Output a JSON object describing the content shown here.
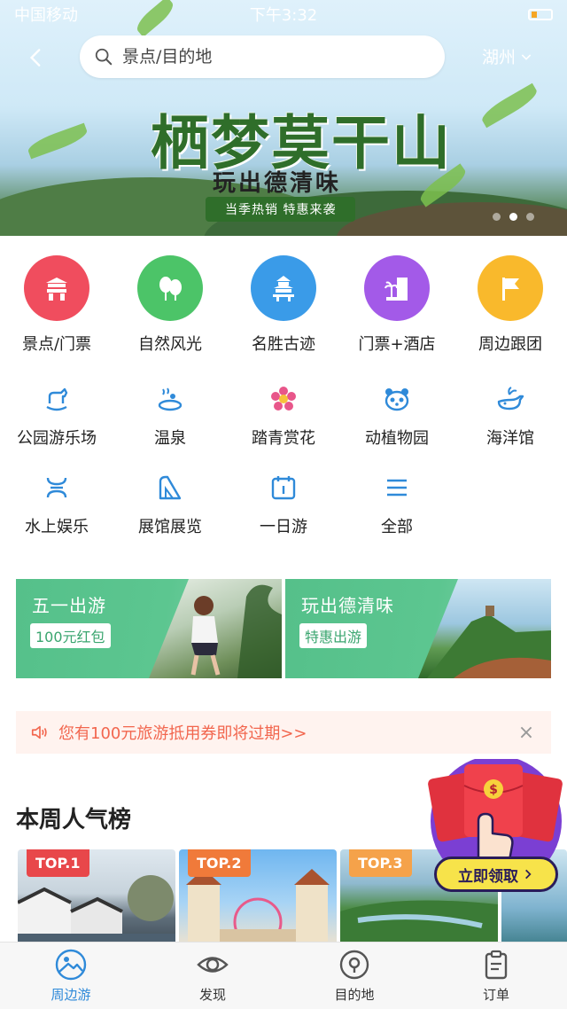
{
  "status_bar": {
    "carrier": "中国移动",
    "time": "下午3:32",
    "battery_icon": "battery-icon"
  },
  "header": {
    "search_placeholder": "景点/目的地",
    "city": "湖州"
  },
  "banner": {
    "title": "栖梦莫干山",
    "subtitle": "玩出德清味",
    "tag": "当季热销  特惠来袭",
    "slide_count": 3,
    "active_slide": 2
  },
  "categories_primary": [
    {
      "label": "景点/门票",
      "icon": "gate-icon",
      "color": "#f04d5e"
    },
    {
      "label": "自然风光",
      "icon": "tree-icon",
      "color": "#4cc468"
    },
    {
      "label": "名胜古迹",
      "icon": "temple-icon",
      "color": "#3a9be8"
    },
    {
      "label": "门票+酒店",
      "icon": "hotel-icon",
      "color": "#a35ae8"
    },
    {
      "label": "周边跟团",
      "icon": "flag-icon",
      "color": "#f9b92c"
    }
  ],
  "categories_secondary": [
    {
      "label": "公园游乐场",
      "icon": "rocking-horse-icon"
    },
    {
      "label": "温泉",
      "icon": "hot-spring-icon"
    },
    {
      "label": "踏青赏花",
      "icon": "flower-icon"
    },
    {
      "label": "动植物园",
      "icon": "panda-icon"
    },
    {
      "label": "海洋馆",
      "icon": "whale-icon"
    }
  ],
  "categories_tertiary": [
    {
      "label": "水上娱乐",
      "icon": "water-ride-icon"
    },
    {
      "label": "展馆展览",
      "icon": "exhibition-icon"
    },
    {
      "label": "一日游",
      "icon": "calendar-icon"
    },
    {
      "label": "全部",
      "icon": "menu-icon"
    }
  ],
  "promos": [
    {
      "title": "五一出游",
      "tag": "100元红包"
    },
    {
      "title": "玩出德清味",
      "tag": "特惠出游"
    }
  ],
  "notice": {
    "text": "您有100元旅游抵用券即将过期>>",
    "close": "×"
  },
  "ranking": {
    "title": "本周人气榜",
    "items": [
      {
        "badge": "TOP.1",
        "badge_color": "#e8474a"
      },
      {
        "badge": "TOP.2",
        "badge_color": "#f07a3a"
      },
      {
        "badge": "TOP.3",
        "badge_color": "#f5a24a"
      }
    ]
  },
  "red_envelope": {
    "claim_label": "立即领取"
  },
  "tabbar": [
    {
      "label": "周边游",
      "icon": "landscape-icon",
      "active": true
    },
    {
      "label": "发现",
      "icon": "eye-icon",
      "active": false
    },
    {
      "label": "目的地",
      "icon": "location-icon",
      "active": false
    },
    {
      "label": "订单",
      "icon": "clipboard-icon",
      "active": false
    }
  ]
}
